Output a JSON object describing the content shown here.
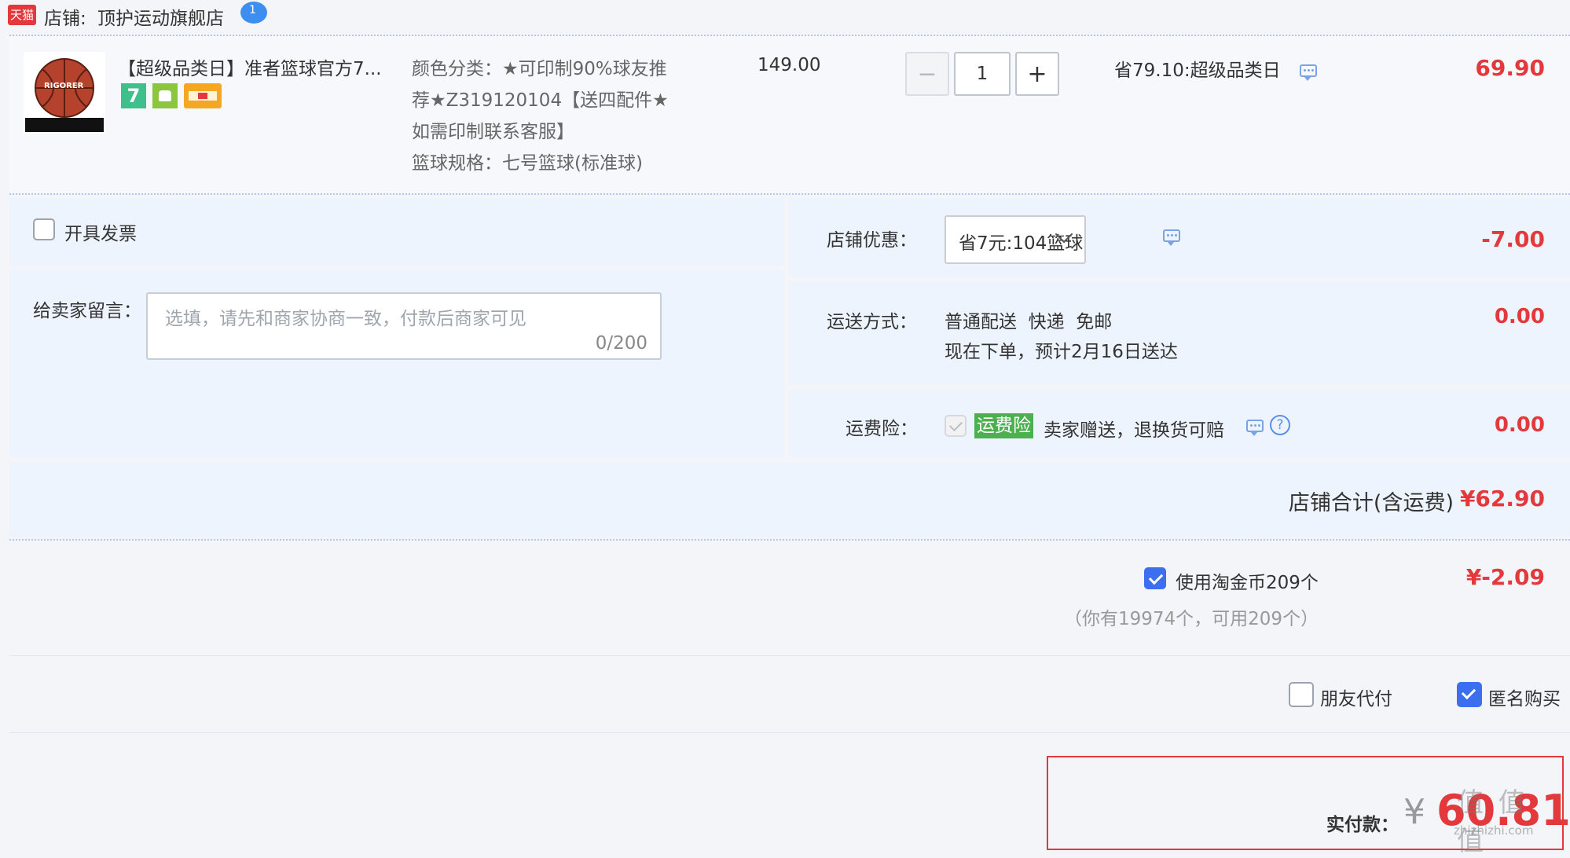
{
  "shop": {
    "badge": "天猫",
    "label": "店铺: ",
    "name": "顶护运动旗舰店",
    "chat_badge": "1"
  },
  "product": {
    "image_icon": "basketball-icon",
    "image_brand_text": "RIGORER",
    "title": "【超级品类日】准者篮球官方7...",
    "service_icons": [
      "7-day-return-icon",
      "android-icon",
      "card-payment-icon"
    ],
    "service_icon_text": "7",
    "spec_lines": [
      "颜色分类：★可印制90%球友推",
      "荐★Z319120104【送四配件★",
      "如需印制联系客服】",
      "篮球规格：七号篮球(标准球)"
    ],
    "unit_price": "149.00",
    "quantity": "1",
    "minus_symbol": "−",
    "plus_symbol": "+",
    "discount": "省79.10:超级品类日",
    "subtotal": "69.90"
  },
  "invoice": {
    "label": "开具发票"
  },
  "message": {
    "label": "给卖家留言：",
    "placeholder": "选填，请先和商家协商一致，付款后商家可见",
    "counter": "0/200"
  },
  "shop_discount": {
    "label": "店铺优惠：",
    "selected": "省7元:104篮球",
    "amount": "-7.00"
  },
  "shipping": {
    "label": "运送方式：",
    "method": "普通配送  快递  免邮",
    "eta": "现在下单，预计2月16日送达",
    "amount": "0.00"
  },
  "insurance": {
    "label": "运费险：",
    "tag": "运费险",
    "desc": "卖家赠送，退换货可赔",
    "help_symbol": "?",
    "amount": "0.00"
  },
  "shop_total": {
    "label": "店铺合计(含运费)",
    "amount": "¥62.90"
  },
  "taojinbi": {
    "label": "使用淘金币209个",
    "note": "（你有19974个，可用209个）",
    "amount": "¥-2.09"
  },
  "options": {
    "friend_pay": "朋友代付",
    "anonymous": "匿名购买"
  },
  "payment": {
    "label": "实付款：",
    "currency": "¥",
    "amount": "60.81"
  },
  "watermark": {
    "text": "值 值 值",
    "site": "zhizhizhi.com"
  },
  "colors": {
    "accent_red": "#e4393c",
    "check_blue": "#3c6ef0",
    "tag_green": "#4caf50",
    "tmall_red": "#e4393c"
  }
}
